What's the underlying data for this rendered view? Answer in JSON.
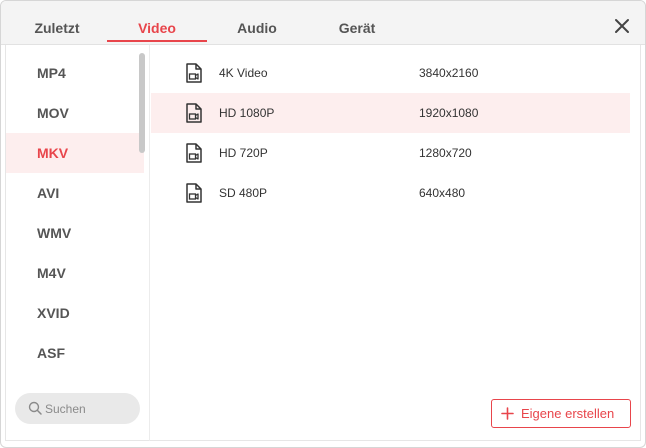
{
  "tabs": [
    {
      "label": "Zuletzt",
      "active": false
    },
    {
      "label": "Video",
      "active": true
    },
    {
      "label": "Audio",
      "active": false
    },
    {
      "label": "Gerät",
      "active": false
    }
  ],
  "formats": [
    {
      "label": "MP4",
      "active": false
    },
    {
      "label": "MOV",
      "active": false
    },
    {
      "label": "MKV",
      "active": true
    },
    {
      "label": "AVI",
      "active": false
    },
    {
      "label": "WMV",
      "active": false
    },
    {
      "label": "M4V",
      "active": false
    },
    {
      "label": "XVID",
      "active": false
    },
    {
      "label": "ASF",
      "active": false
    }
  ],
  "presets": [
    {
      "name": "4K Video",
      "resolution": "3840x2160",
      "icon": "video-file-icon",
      "active": false
    },
    {
      "name": "HD 1080P",
      "resolution": "1920x1080",
      "icon": "video-file-icon",
      "active": true
    },
    {
      "name": "HD 720P",
      "resolution": "1280x720",
      "icon": "video-file-icon",
      "active": false
    },
    {
      "name": "SD 480P",
      "resolution": "640x480",
      "icon": "video-file-icon",
      "active": false
    }
  ],
  "search": {
    "placeholder": "Suchen",
    "value": ""
  },
  "create_button": {
    "label": "Eigene erstellen"
  },
  "colors": {
    "accent": "#e8454b",
    "active_bg": "#fdeeee"
  }
}
